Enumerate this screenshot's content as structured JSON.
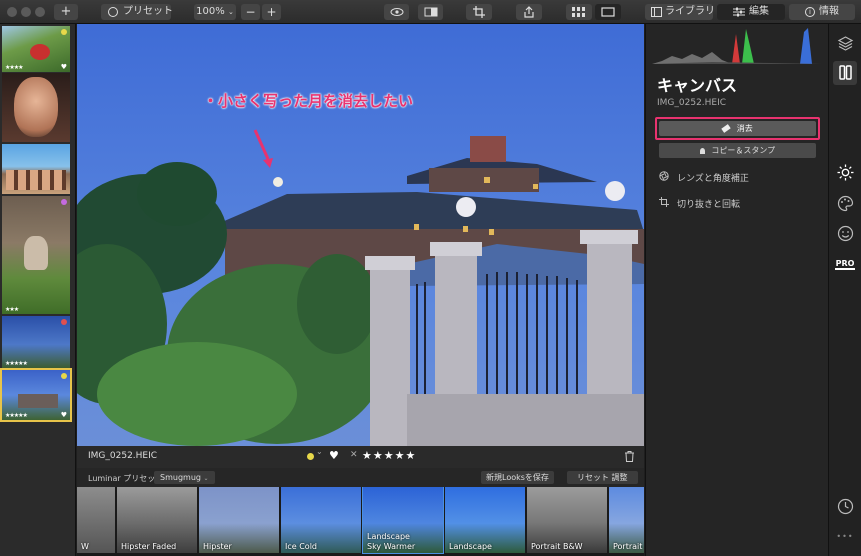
{
  "toolbar": {
    "presets_label": "プリセット",
    "zoom_label": "100%",
    "zoom_out": "−",
    "zoom_in": "+",
    "add_label": "+",
    "library_tab": "ライブラリ",
    "edit_tab": "編集",
    "info_tab": "情報"
  },
  "canvas": {
    "annotation": "・小さく写った月を消去したい"
  },
  "infobar": {
    "filename": "IMG_0252.HEIC",
    "rating_stars": "★★★★★",
    "reject": "✕",
    "heart": "♥",
    "color_label": "⌄"
  },
  "looksbar": {
    "luminar_label": "Luminar プリセット",
    "collection": "Smugmug",
    "save_looks": "新規Looksを保存",
    "reset": "リセット 調整"
  },
  "looks": [
    {
      "label": "W"
    },
    {
      "label": "Hipster Faded"
    },
    {
      "label": "Hipster"
    },
    {
      "label": "Ice Cold"
    },
    {
      "label": "Sky Warmer",
      "top": "Landscape"
    },
    {
      "label": "Landscape"
    },
    {
      "label": "Portrait B&W"
    },
    {
      "label": "Portrait"
    }
  ],
  "filmstrip": [
    {
      "stars": "★★★★",
      "dot": "#e8d84a"
    },
    {
      "stars": "",
      "dot": ""
    },
    {
      "stars": "",
      "dot": ""
    },
    {
      "stars": "★★★",
      "dot": "#c56adf"
    },
    {
      "stars": "★★★★★",
      "dot": "#e05050"
    },
    {
      "stars": "★★★★★",
      "dot": "#e8d84a"
    }
  ],
  "panel": {
    "title": "キャンバス",
    "filename": "IMG_0252.HEIC",
    "erase_button": "消去",
    "clone_button": "コピー＆スタンプ",
    "lens_item": "レンズと角度補正",
    "crop_item": "切り抜きと回転"
  },
  "sidebar": {
    "pro_label": "PRO",
    "more_label": "•••"
  },
  "colors": {
    "highlight": "#e8336f",
    "accent": "#4a90e2"
  }
}
